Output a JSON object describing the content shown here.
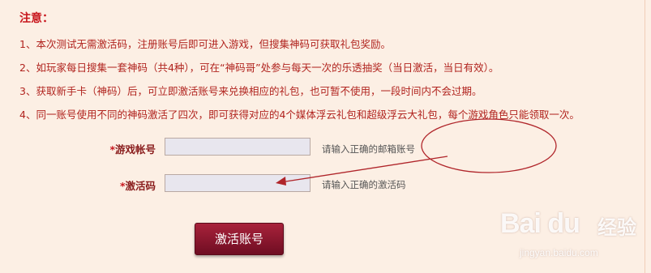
{
  "notice": {
    "title": "注意：",
    "items": [
      "1、本次测试无需激活码，注册账号后即可进入游戏，但搜集神码可获取礼包奖励。",
      "2、如玩家每日搜集一套神码（共4种），可在“神码哥”处参与每天一次的乐透抽奖（当日激活，当日有效）。",
      "3、获取新手卡（神码）后，可立即激活账号来兑换相应的礼包，也可暂不使用，一段时间内不会过期。",
      "4、同一账号使用不同的神码激活了四次，即可获得对应的4个媒体浮云礼包和超级浮云大礼包，每个游戏角色只能领取一次。"
    ]
  },
  "form": {
    "required_mark": "*",
    "account_label": "游戏帐号",
    "account_value": "",
    "account_hint": "请输入正确的邮箱账号",
    "code_label": "激活码",
    "code_value": "",
    "code_hint": "请输入正确的激活码",
    "submit_label": "激活账号"
  },
  "annotation": {
    "color": "#b0252a"
  },
  "watermark": {
    "logo": "Bai du",
    "name": "经验",
    "url": "jingyan.baidu.com"
  }
}
